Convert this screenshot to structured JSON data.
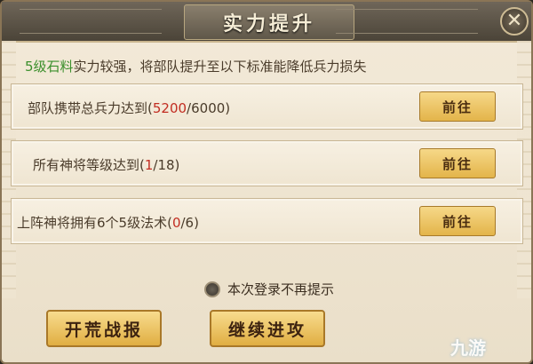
{
  "dialog": {
    "title": "实力提升",
    "close_symbol": "✕",
    "intro_highlight": "5级石料",
    "intro_rest": "实力较强，将部队提升至以下标准能降低兵力损失"
  },
  "requirements": [
    {
      "prefix": "部队携带总兵力达到(",
      "current": "5200",
      "suffix": "/6000)",
      "button": "前往"
    },
    {
      "prefix": "所有神将等级达到(",
      "current": "1",
      "suffix": "/18)",
      "button": "前往"
    },
    {
      "prefix": "上阵神将拥有6个5级法术(",
      "current": "0",
      "suffix": "/6)",
      "button": "前往"
    }
  ],
  "checkbox": {
    "label": "本次登录不再提示"
  },
  "buttons": {
    "report": "开荒战报",
    "continue": "继续进攻"
  },
  "watermark": "九游",
  "colors": {
    "highlight_green": "#3b8f2c",
    "current_red": "#c22d22",
    "button_gold": "#e3b44a"
  }
}
